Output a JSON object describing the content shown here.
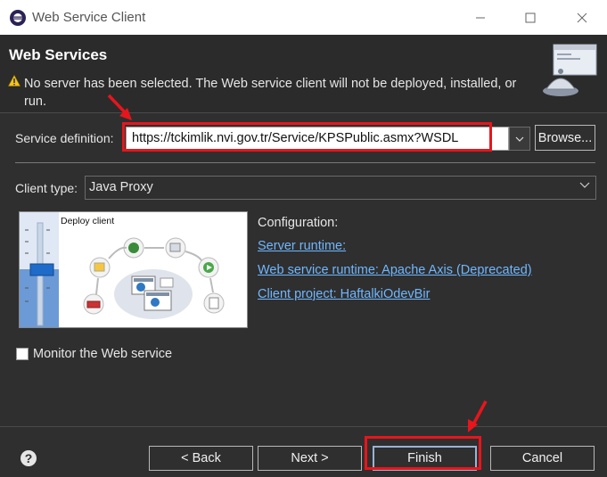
{
  "window": {
    "title": "Web Service Client"
  },
  "header": {
    "title": "Web Services",
    "warning": "No server has been selected. The Web service client will not be deployed, installed, or run."
  },
  "service": {
    "label": "Service definition:",
    "value": "https://tckimlik.nvi.gov.tr/Service/KPSPublic.asmx?WSDL",
    "browse_label": "Browse..."
  },
  "client_type": {
    "label": "Client type:",
    "value": "Java Proxy"
  },
  "diagram": {
    "caption": "Deploy client"
  },
  "configuration": {
    "title": "Configuration:",
    "server_runtime": "Server runtime: ",
    "ws_runtime": "Web service runtime: Apache Axis (Deprecated)",
    "client_project": "Client project: HaftalkiOdevBir"
  },
  "monitor": {
    "label": "Monitor the Web service",
    "checked": false
  },
  "footer": {
    "back_label": "< Back",
    "next_label": "Next >",
    "finish_label": "Finish",
    "cancel_label": "Cancel"
  },
  "colors": {
    "annotation": "#e8151c",
    "link": "#6fb7ff",
    "background": "#2f2f2f"
  }
}
